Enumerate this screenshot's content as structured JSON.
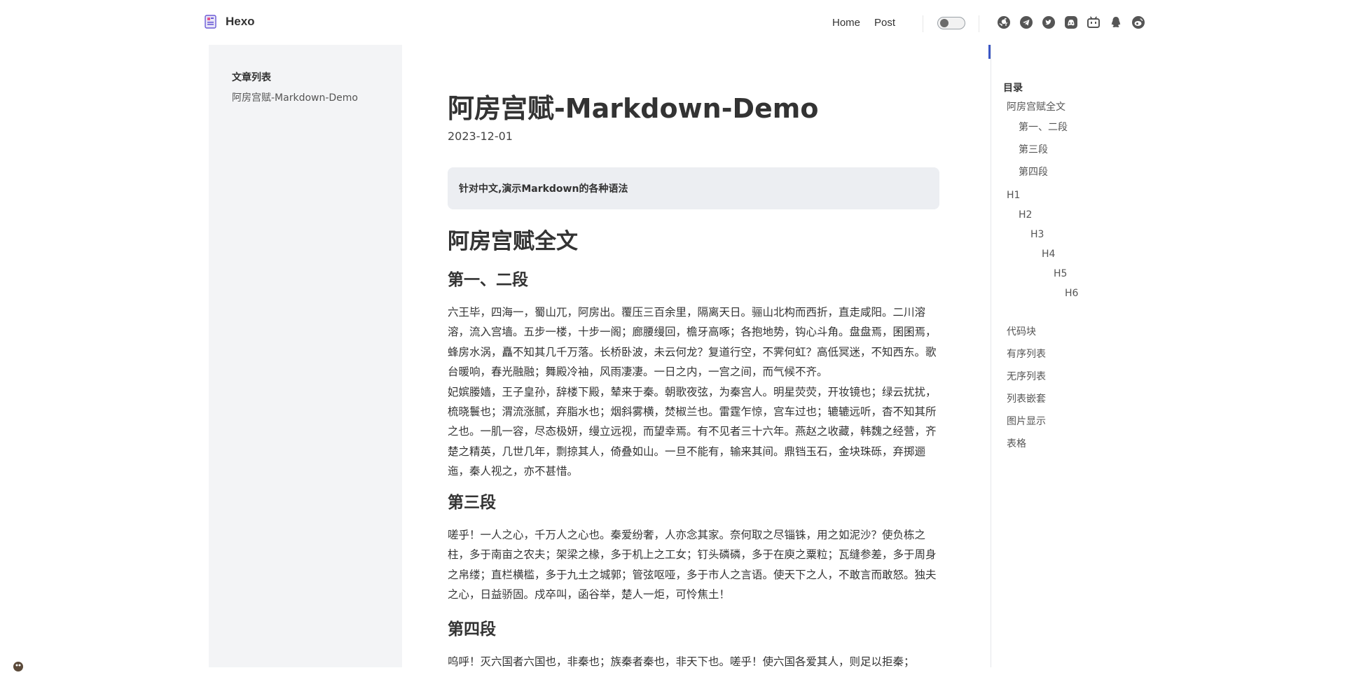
{
  "brand": {
    "title": "Hexo"
  },
  "nav": {
    "home": "Home",
    "post": "Post"
  },
  "theme_toggle": {
    "state": "off"
  },
  "social_icons": [
    "github-icon",
    "telegram-icon",
    "twitter-icon",
    "discord-icon",
    "bilibili-icon",
    "qq-icon",
    "weibo-icon"
  ],
  "sidebar": {
    "heading": "文章列表",
    "items": [
      "阿房宫赋-Markdown-Demo"
    ]
  },
  "article": {
    "title": "阿房宫赋-Markdown-Demo",
    "date": "2023-12-01",
    "summary": "针对中文,演示Markdown的各种语法",
    "h1": "阿房宫赋全文",
    "sections": [
      {
        "heading": "第一、二段",
        "paragraphs": [
          "六王毕，四海一，蜀山兀，阿房出。覆压三百余里，隔离天日。骊山北构而西折，直走咸阳。二川溶溶，流入宫墙。五步一楼，十步一阁；廊腰缦回，檐牙高啄；各抱地势，钩心斗角。盘盘焉，囷囷焉，蜂房水涡，矗不知其几千万落。长桥卧波，未云何龙？复道行空，不霁何虹？高低冥迷，不知西东。歌台暖响，春光融融；舞殿冷袖，风雨凄凄。一日之内，一宫之间，而气候不齐。",
          "妃嫔媵嫱，王子皇孙，辞楼下殿，辇来于秦。朝歌夜弦，为秦宫人。明星荧荧，开妆镜也；绿云扰扰，梳晓鬟也；渭流涨腻，弃脂水也；烟斜雾横，焚椒兰也。雷霆乍惊，宫车过也；辘辘远听，杳不知其所之也。一肌一容，尽态极妍，缦立远视，而望幸焉。有不见者三十六年。燕赵之收藏，韩魏之经营，齐楚之精英，几世几年，剽掠其人，倚叠如山。一旦不能有，输来其间。鼎铛玉石，金块珠砾，弃掷逦迤，秦人视之，亦不甚惜。"
        ]
      },
      {
        "heading": "第三段",
        "paragraphs": [
          "嗟乎！一人之心，千万人之心也。秦爱纷奢，人亦念其家。奈何取之尽锱铢，用之如泥沙？使负栋之柱，多于南亩之农夫；架梁之椽，多于机上之工女；钉头磷磷，多于在庾之粟粒；瓦缝参差，多于周身之帛缕；直栏横槛，多于九土之城郭；管弦呕哑，多于市人之言语。使天下之人，不敢言而敢怒。独夫之心，日益骄固。戍卒叫，函谷举，楚人一炬，可怜焦土！"
        ]
      },
      {
        "heading": "第四段",
        "paragraphs": [
          "呜呼！灭六国者六国也，非秦也；族秦者秦也，非天下也。嗟乎！使六国各爱其人，则足以拒秦；"
        ]
      }
    ]
  },
  "toc": {
    "title": "目录",
    "items": [
      {
        "label": "阿房宫赋全文"
      },
      {
        "label": "第一、二段"
      },
      {
        "label": "第三段"
      },
      {
        "label": "第四段"
      },
      {
        "label": "H1"
      },
      {
        "label": "H2"
      },
      {
        "label": "H3"
      },
      {
        "label": "H4"
      },
      {
        "label": "H5"
      },
      {
        "label": "H6"
      },
      {
        "label": "代码块"
      },
      {
        "label": "有序列表"
      },
      {
        "label": "无序列表"
      },
      {
        "label": "列表嵌套"
      },
      {
        "label": "图片显示"
      },
      {
        "label": "表格"
      }
    ]
  }
}
